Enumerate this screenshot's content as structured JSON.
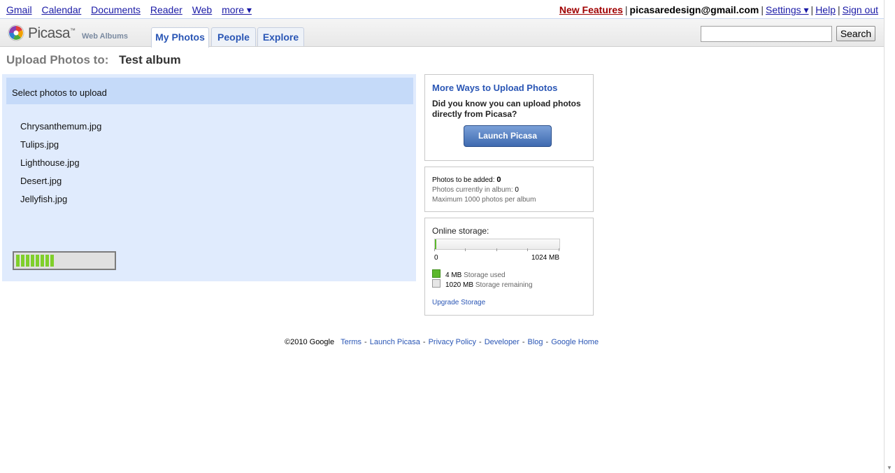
{
  "topbar": {
    "links": [
      "Gmail",
      "Calendar",
      "Documents",
      "Reader",
      "Web",
      "more ▾"
    ],
    "new_features": "New Features",
    "email": "picasaredesign@gmail.com",
    "settings": "Settings ▾",
    "help": "Help",
    "signout": "Sign out",
    "separator": "|"
  },
  "header": {
    "logo_text": "Picasa",
    "logo_tm": "™",
    "logo_sub": "Web Albums",
    "tabs": [
      {
        "label": "My Photos",
        "active": true
      },
      {
        "label": "People",
        "active": false
      },
      {
        "label": "Explore",
        "active": false
      }
    ],
    "search_button": "Search",
    "search_value": ""
  },
  "page": {
    "title_label": "Upload Photos to:",
    "album": "Test album"
  },
  "upload": {
    "heading": "Select photos to upload",
    "files": [
      "Chrysanthemum.jpg",
      "Tulips.jpg",
      "Lighthouse.jpg",
      "Desert.jpg",
      "Jellyfish.jpg"
    ],
    "progress_fraction": 0.4
  },
  "more_ways": {
    "title": "More Ways to Upload Photos",
    "description": "Did you know you can upload photos directly from Picasa?",
    "button": "Launch Picasa"
  },
  "counts": {
    "to_add_label": "Photos to be added:",
    "to_add_value": "0",
    "in_album_label": "Photos currently in album:",
    "in_album_value": "0",
    "max_note": "Maximum 1000 photos per album"
  },
  "storage": {
    "title": "Online storage:",
    "scale_min": "0",
    "scale_max": "1024 MB",
    "used_value": "4 MB",
    "used_label": "Storage used",
    "remaining_value": "1020 MB",
    "remaining_label": "Storage remaining",
    "used_fraction": 0.0039,
    "upgrade": "Upgrade Storage",
    "used_color": "#5cb82c",
    "remaining_color": "#e6e6e6"
  },
  "footer": {
    "copyright": "©2010 Google",
    "links": [
      "Terms",
      "Launch Picasa",
      "Privacy Policy",
      "Developer",
      "Blog",
      "Google Home"
    ],
    "separator": "-"
  },
  "colors": {
    "accent": "#2a56b5",
    "upload_panel": "#e0ebfd",
    "upload_header": "#c5daf9",
    "new_features": "#a00000",
    "progress": "#7fcf2a"
  }
}
